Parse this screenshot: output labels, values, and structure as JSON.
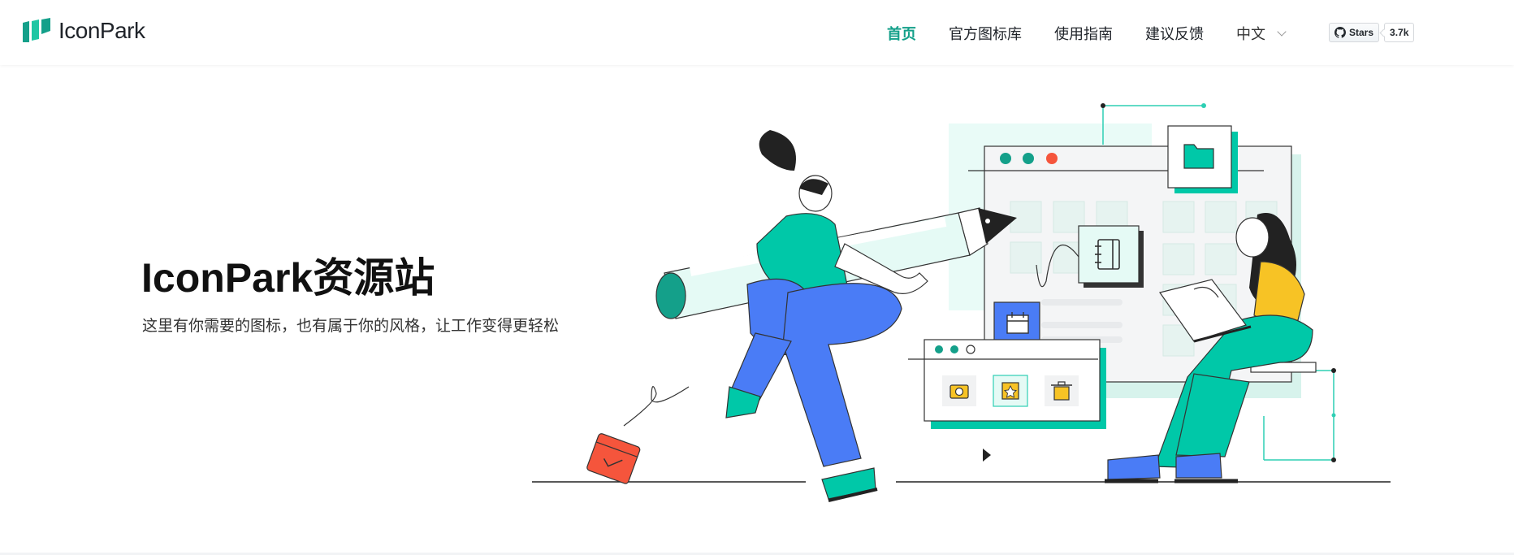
{
  "header": {
    "logo_text": "IconPark",
    "nav": [
      {
        "label": "首页",
        "active": true
      },
      {
        "label": "官方图标库",
        "active": false
      },
      {
        "label": "使用指南",
        "active": false
      },
      {
        "label": "建议反馈",
        "active": false
      }
    ],
    "language": {
      "label": "中文",
      "icon": "chevron-down-icon"
    },
    "github": {
      "stars_label": "Stars",
      "count": "3.7k",
      "icon": "github-icon"
    }
  },
  "hero": {
    "title": "IconPark资源站",
    "subtitle": "这里有你需要的图标，也有属于你的风格，让工作变得更轻松"
  },
  "colors": {
    "accent": "#14a08a",
    "teal": "#00c8a8",
    "blue": "#4a7cf6",
    "yellow": "#f7c325",
    "red": "#f5553c"
  },
  "illustration": {
    "icons": [
      "folder-icon",
      "notebook-icon",
      "calendar-icon",
      "camera-icon",
      "star-icon",
      "trash-icon",
      "pen-icon",
      "laptop-icon",
      "cursor-icon"
    ]
  }
}
